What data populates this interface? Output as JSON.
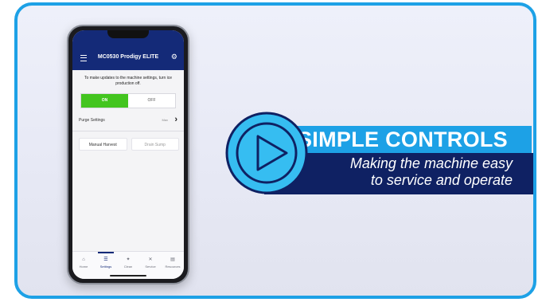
{
  "phone": {
    "app_title": "MC0530 Prodigy ELITE",
    "notice": "To make updates to the machine settings, turn ice production off.",
    "toggle_on": "ON",
    "toggle_off": "OFF",
    "purge_label": "Purge Settings",
    "purge_value": "Max",
    "manual_harvest": "Manual Harvest",
    "drain_sump": "Drain Sump",
    "tabs": [
      {
        "label": "Home",
        "icon": "home-icon"
      },
      {
        "label": "Settings",
        "icon": "settings-sliders-icon",
        "active": true
      },
      {
        "label": "Clean",
        "icon": "sparkle-icon"
      },
      {
        "label": "Service",
        "icon": "wrench-icon"
      },
      {
        "label": "Resources",
        "icon": "document-icon"
      }
    ]
  },
  "banner": {
    "headline": "SIMPLE CONTROLS",
    "subline1": "Making the machine easy",
    "subline2": "to service and operate"
  },
  "colors": {
    "frame_border": "#1da1e6",
    "app_bar": "#142a78",
    "toggle_on": "#43c51f",
    "headline_band": "#1da1e6",
    "subline_band": "#0f2163",
    "play_button": "#36bdf1"
  }
}
